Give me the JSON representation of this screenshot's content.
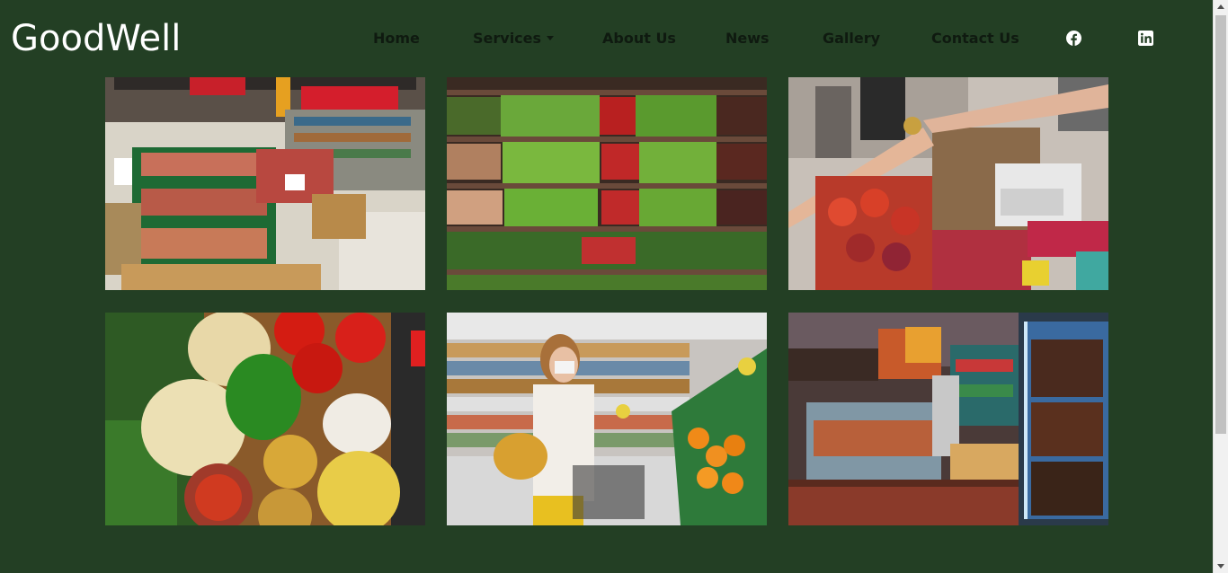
{
  "brand": {
    "name": "GoodWell"
  },
  "nav": {
    "items": [
      {
        "label": "Home"
      },
      {
        "label": "Services",
        "has_dropdown": true
      },
      {
        "label": "About Us"
      },
      {
        "label": "News"
      },
      {
        "label": "Gallery"
      },
      {
        "label": "Contact Us"
      }
    ],
    "social": [
      {
        "icon": "facebook-icon"
      },
      {
        "icon": "linkedin-icon"
      }
    ]
  },
  "gallery": {
    "images": [
      {
        "subject": "supermarket-produce-aisle"
      },
      {
        "subject": "vegetable-shelves"
      },
      {
        "subject": "market-fruit-handover"
      },
      {
        "subject": "onions-peppers-tomatoes-spices"
      },
      {
        "subject": "shopper-with-basket"
      },
      {
        "subject": "convenience-store-counter"
      }
    ]
  },
  "colors": {
    "background": "#233f24",
    "brand_text": "#ffffff",
    "nav_text": "#0f1a10"
  }
}
